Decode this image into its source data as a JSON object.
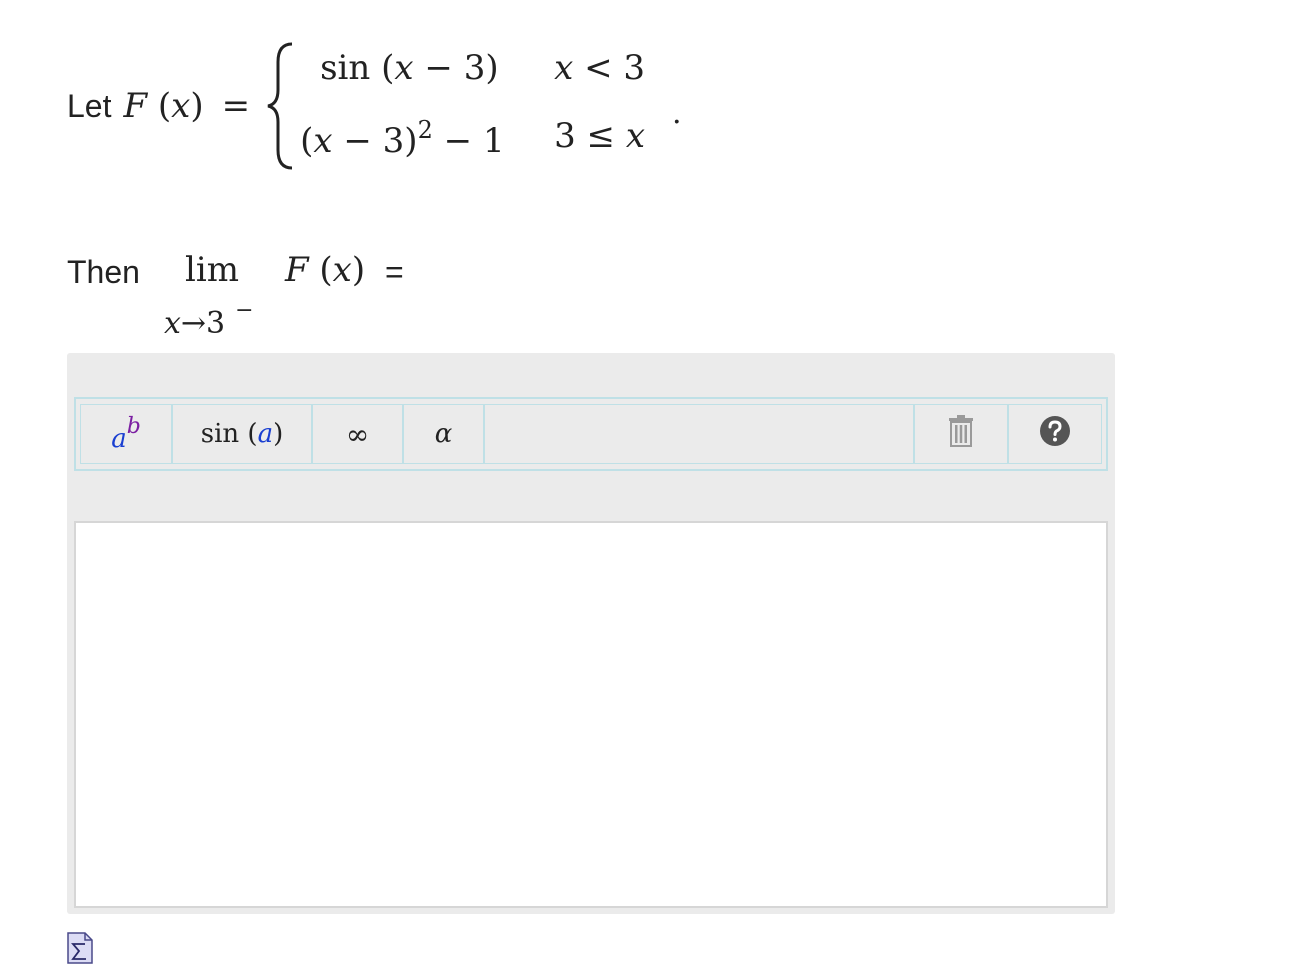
{
  "statement": {
    "lead": "Let",
    "func": "F",
    "var": "x",
    "eq": "=",
    "case1_expr_fn": "sin",
    "case1_expr_arg_var": "x",
    "case1_expr_arg_rest": "− 3)",
    "case1_cond_var": "x",
    "case1_cond_rest": "< 3",
    "case2_expr_var": "x",
    "case2_expr_open": "(",
    "case2_expr_mid": "− 3)",
    "case2_exp": "2",
    "case2_expr_tail": "− 1",
    "case2_cond_lead": "3 ≤",
    "case2_cond_var": "x",
    "period": "."
  },
  "question": {
    "lead": "Then",
    "lim": "lim",
    "sub_var": "x",
    "sub_rest": "→3",
    "sub_side": "−",
    "func": "F",
    "var": "x",
    "eq": "="
  },
  "toolbar": {
    "superscript": {
      "base": "a",
      "exp": "b"
    },
    "function": {
      "name": "sin",
      "arg": "a"
    },
    "infinity": "∞",
    "greek": "α"
  },
  "answer": {
    "value": ""
  },
  "colors": {
    "toolbar_border": "#bfe0e6",
    "panel_bg": "#ebebeb",
    "var_blue": "#1a3fd1",
    "var_purple": "#7b1fa2"
  },
  "icons": {
    "trash": "trash-icon",
    "help": "help-icon",
    "formula": "formula-doc-icon"
  }
}
